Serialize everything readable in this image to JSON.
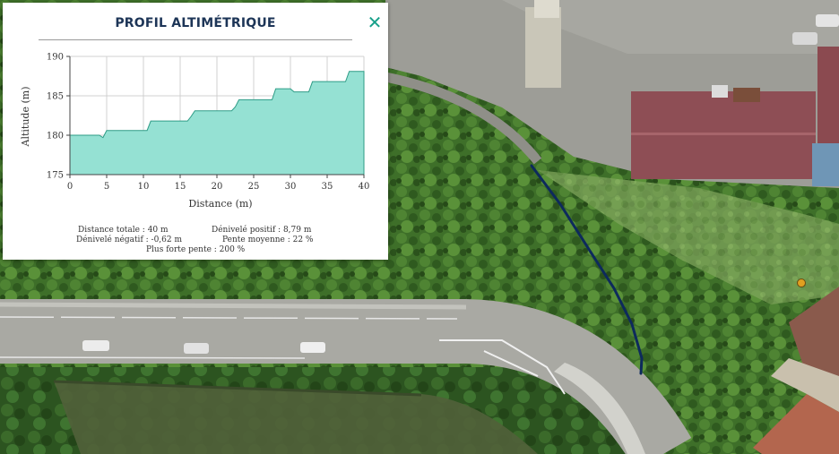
{
  "panel": {
    "title": "PROFIL ALTIMÉTRIQUE",
    "close_icon": "close-icon"
  },
  "stats": {
    "distance_totale": "Distance totale : 40 m",
    "denivele_positif": "Dénivelé positif : 8,79 m",
    "denivele_negatif": "Dénivelé négatif : -0,62 m",
    "pente_moyenne": "Pente moyenne : 22 %",
    "plus_forte_pente": "Plus forte pente : 200 %"
  },
  "colors": {
    "profile_fill": "#95e1d3",
    "profile_stroke": "#2e9c86",
    "route_line": "#0d2a5c",
    "marker": "#e0a020",
    "accent": "#18a08a",
    "title": "#1d3557"
  },
  "chart_data": {
    "type": "area",
    "xlabel": "Distance (m)",
    "ylabel": "Altitude (m)",
    "xlim": [
      0,
      40
    ],
    "ylim": [
      175,
      190
    ],
    "x_ticks": [
      0,
      5,
      10,
      15,
      20,
      25,
      30,
      35,
      40
    ],
    "y_ticks": [
      175,
      180,
      185,
      190
    ],
    "grid": true,
    "x": [
      0,
      4,
      4.5,
      5,
      10,
      10.5,
      11,
      16,
      16.5,
      17,
      22,
      22.5,
      23,
      27.5,
      28,
      30,
      30.5,
      32.5,
      33,
      37.5,
      38,
      40
    ],
    "y": [
      180.0,
      180.0,
      179.7,
      180.6,
      180.6,
      180.6,
      181.8,
      181.8,
      182.4,
      183.1,
      183.1,
      183.6,
      184.5,
      184.5,
      185.9,
      185.9,
      185.5,
      185.5,
      186.8,
      186.8,
      188.1,
      188.1
    ]
  }
}
